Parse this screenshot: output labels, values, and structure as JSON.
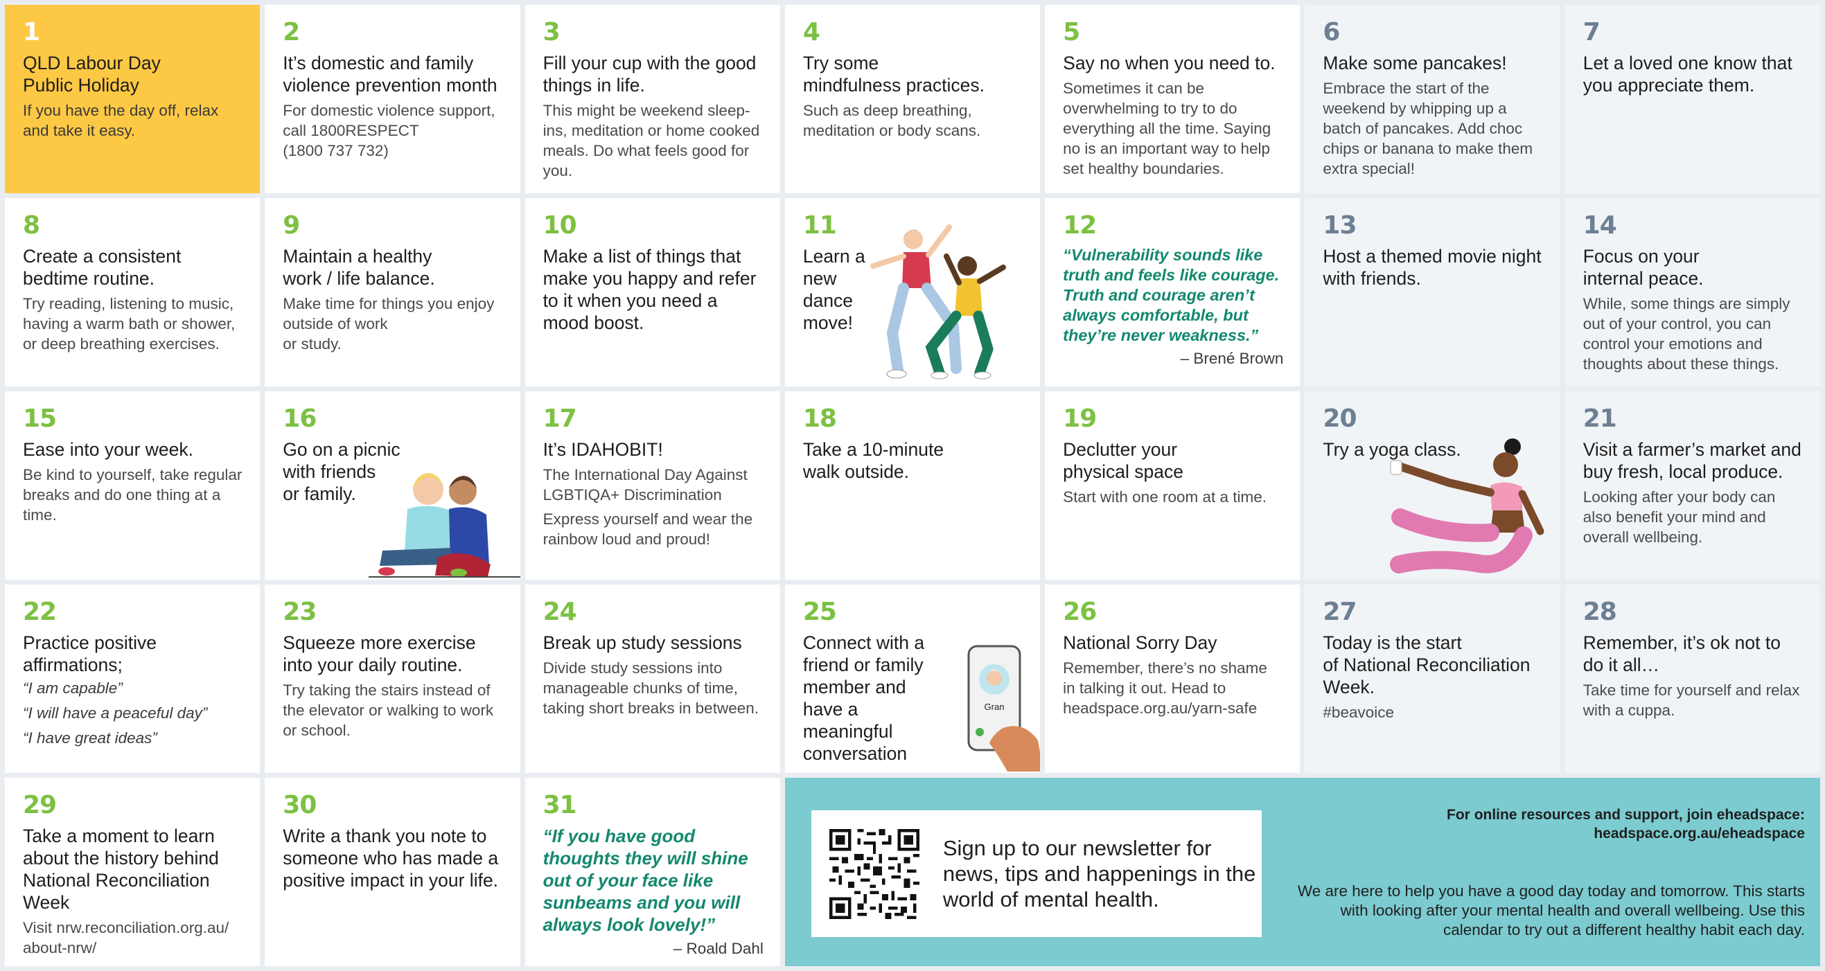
{
  "days": [
    {
      "num": "1",
      "title": "QLD Labour Day\nPublic Holiday",
      "body": "If you have the day off, relax and take it easy."
    },
    {
      "num": "2",
      "title": "It’s domestic and family violence prevention month",
      "body": "For domestic violence support, call 1800RESPECT\n(1800 737 732)"
    },
    {
      "num": "3",
      "title": "Fill your cup with the good things in life.",
      "body": "This might be weekend sleep-ins, meditation or home cooked meals. Do what feels good for you."
    },
    {
      "num": "4",
      "title": "Try some\nmindfulness practices.",
      "body": "Such as deep breathing, meditation or body scans."
    },
    {
      "num": "5",
      "title": "Say no when you need to.",
      "body": "Sometimes it can be overwhelming to try to do everything all the time. Saying no is an important way to help set healthy boundaries."
    },
    {
      "num": "6",
      "title": "Make some pancakes!",
      "body": "Embrace the start of the weekend by whipping up a batch of pancakes. Add choc chips or banana to make them extra special!"
    },
    {
      "num": "7",
      "title": "Let a loved one know that you appreciate them.",
      "body": ""
    },
    {
      "num": "8",
      "title": "Create a consistent bedtime routine.",
      "body": "Try reading, listening to music, having a warm bath or shower, or deep breathing exercises."
    },
    {
      "num": "9",
      "title": "Maintain a healthy\nwork / life balance.",
      "body": "Make time for things you enjoy outside of work\nor study."
    },
    {
      "num": "10",
      "title": "Make a list of things that make you happy and refer to it when you need a\nmood boost.",
      "body": ""
    },
    {
      "num": "11",
      "title": "Learn a\nnew\ndance\nmove!",
      "body": ""
    },
    {
      "num": "12",
      "quote": "“Vulnerability sounds like truth and feels like courage. Truth and courage aren’t always comfortable, but they’re never weakness.”",
      "author": "– Brené Brown"
    },
    {
      "num": "13",
      "title": "Host a themed movie night with friends.",
      "body": ""
    },
    {
      "num": "14",
      "title": "Focus on your\ninternal peace.",
      "body": "While, some things are simply out of your control, you can control your emotions and thoughts about these things."
    },
    {
      "num": "15",
      "title": "Ease into your week.",
      "body": "Be kind to yourself, take regular breaks and do one thing at a time."
    },
    {
      "num": "16",
      "title": "Go on a picnic\nwith friends\nor family.",
      "body": ""
    },
    {
      "num": "17",
      "title": "It’s IDAHOBIT!",
      "body": "The International Day Against LGBTIQA+ Discrimination",
      "body2": "Express yourself and wear the rainbow loud and proud!"
    },
    {
      "num": "18",
      "title": "Take a 10-minute\nwalk outside.",
      "body": ""
    },
    {
      "num": "19",
      "title": "Declutter your\nphysical space",
      "body": "Start with one room at a time."
    },
    {
      "num": "20",
      "title": "Try a yoga class.",
      "body": ""
    },
    {
      "num": "21",
      "title": "Visit a farmer’s market and buy fresh, local produce.",
      "body": "Looking after your body can also benefit your mind and overall wellbeing."
    },
    {
      "num": "22",
      "title": "Practice positive affirmations;",
      "italics": [
        "“I am capable”",
        "“I will have a peaceful day”",
        "“I have great ideas”"
      ]
    },
    {
      "num": "23",
      "title": "Squeeze more exercise into your daily routine.",
      "body": "Try taking the stairs instead of the elevator or walking to work or school."
    },
    {
      "num": "24",
      "title": "Break up study sessions",
      "body": "Divide study sessions into manageable chunks of time, taking short breaks in between."
    },
    {
      "num": "25",
      "title": "Connect with\na friend or family member and have a meaningful conversation",
      "body": ""
    },
    {
      "num": "26",
      "title": "National Sorry Day",
      "body": "Remember, there’s no shame in talking it out. Head to headspace.org.au/yarn-safe"
    },
    {
      "num": "27",
      "title": "Today is the start\nof National Reconciliation Week.",
      "body": "#beavoice"
    },
    {
      "num": "28",
      "title": "Remember, it’s ok not to do it all…",
      "body": "Take time for yourself and relax with a cuppa."
    },
    {
      "num": "29",
      "title": "Take a moment to learn about the history behind National Reconciliation Week",
      "body": "Visit nrw.reconciliation.org.au/\nabout-nrw/"
    },
    {
      "num": "30",
      "title": "Write a thank you note to someone who has made a positive impact in your life.",
      "body": ""
    },
    {
      "num": "31",
      "quote": "“If you have good thoughts they will shine out of your face like sunbeams and you will always look lovely!”",
      "author": "– Roald Dahl"
    }
  ],
  "promo": {
    "newsletter": "Sign up to our newsletter for news, tips and happenings in the world of mental health.",
    "join": "For online resources and support, join eheadspace:\nheadspace.org.au/eheadspace",
    "about": "We are here to help you have a good day today and tomorrow. This starts with looking after your mental health and overall wellbeing. Use this calendar to try out a different healthy habit each day."
  },
  "phone_caller": "Gran",
  "colors": {
    "green": "#7cc142",
    "teal": "#7ccbd0",
    "holiday": "#fdc844",
    "quote": "#14886e"
  }
}
